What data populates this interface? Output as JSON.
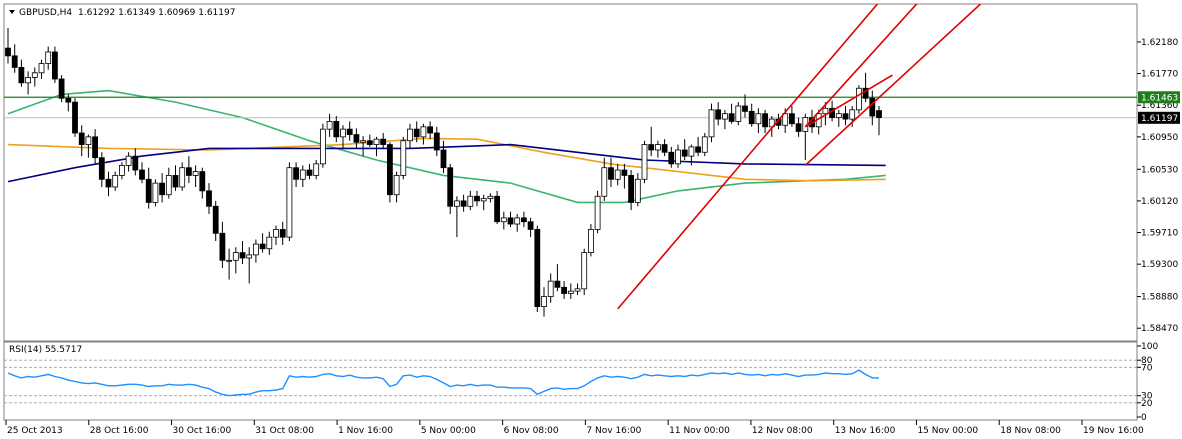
{
  "chart_data": {
    "type": "candlestick",
    "symbol_header": "GBPUSD,H4",
    "ohlc_header": "1.61292 1.61349 1.60969 1.61197",
    "y_ticks": [
      "1.62180",
      "1.61770",
      "1.61360",
      "1.60950",
      "1.60530",
      "1.60120",
      "1.59710",
      "1.59300",
      "1.58880",
      "1.58470"
    ],
    "ylim": [
      1.5833,
      1.6262
    ],
    "x_tick_labels": [
      "25 Oct 2013",
      "28 Oct 16:00",
      "30 Oct 16:00",
      "31 Oct 08:00",
      "1 Nov 16:00",
      "5 Nov 00:00",
      "6 Nov 08:00",
      "7 Nov 16:00",
      "11 Nov 00:00",
      "12 Nov 08:00",
      "13 Nov 16:00",
      "15 Nov 00:00",
      "18 Nov 08:00",
      "19 Nov 16:00"
    ],
    "resistance_level": {
      "value": 1.61463,
      "label": "1.61463",
      "color": "#1e7e1e"
    },
    "current_price": {
      "value": 1.61197,
      "label": "1.61197"
    },
    "candles": [
      [
        1.621,
        1.6236,
        1.619,
        1.62
      ],
      [
        1.62,
        1.6215,
        1.6178,
        1.6185
      ],
      [
        1.6185,
        1.6195,
        1.616,
        1.6165
      ],
      [
        1.6165,
        1.618,
        1.615,
        1.6172
      ],
      [
        1.6172,
        1.6185,
        1.616,
        1.6178
      ],
      [
        1.6178,
        1.6195,
        1.617,
        1.619
      ],
      [
        1.619,
        1.6212,
        1.6182,
        1.6205
      ],
      [
        1.6205,
        1.6212,
        1.6165,
        1.617
      ],
      [
        1.617,
        1.6175,
        1.614,
        1.6145
      ],
      [
        1.6145,
        1.615,
        1.6128,
        1.614
      ],
      [
        1.614,
        1.6145,
        1.6095,
        1.61
      ],
      [
        1.61,
        1.611,
        1.607,
        1.6085
      ],
      [
        1.6085,
        1.6098,
        1.6068,
        1.6095
      ],
      [
        1.6095,
        1.6105,
        1.606,
        1.6068
      ],
      [
        1.6068,
        1.6075,
        1.603,
        1.604
      ],
      [
        1.604,
        1.605,
        1.6018,
        1.603
      ],
      [
        1.603,
        1.605,
        1.6025,
        1.6045
      ],
      [
        1.6045,
        1.6062,
        1.604,
        1.6058
      ],
      [
        1.6058,
        1.6075,
        1.605,
        1.607
      ],
      [
        1.607,
        1.608,
        1.6045,
        1.6052
      ],
      [
        1.6052,
        1.6062,
        1.6035,
        1.604
      ],
      [
        1.604,
        1.6055,
        1.6002,
        1.601
      ],
      [
        1.601,
        1.604,
        1.6005,
        1.6035
      ],
      [
        1.6035,
        1.6048,
        1.601,
        1.602
      ],
      [
        1.602,
        1.6055,
        1.6015,
        1.6045
      ],
      [
        1.6045,
        1.6058,
        1.6025,
        1.603
      ],
      [
        1.603,
        1.6062,
        1.6025,
        1.6055
      ],
      [
        1.6055,
        1.607,
        1.6035,
        1.6045
      ],
      [
        1.6045,
        1.6058,
        1.603,
        1.605
      ],
      [
        1.605,
        1.6055,
        1.6015,
        1.6025
      ],
      [
        1.6025,
        1.6035,
        1.5995,
        1.6005
      ],
      [
        1.6005,
        1.6012,
        1.596,
        1.597
      ],
      [
        1.597,
        1.5985,
        1.5925,
        1.5935
      ],
      [
        1.5935,
        1.595,
        1.591,
        1.5935
      ],
      [
        1.5935,
        1.5952,
        1.5918,
        1.5945
      ],
      [
        1.5945,
        1.596,
        1.593,
        1.5938
      ],
      [
        1.5938,
        1.5952,
        1.5905,
        1.5942
      ],
      [
        1.5942,
        1.5962,
        1.5932,
        1.5956
      ],
      [
        1.5956,
        1.597,
        1.5945,
        1.595
      ],
      [
        1.595,
        1.5972,
        1.5942,
        1.5965
      ],
      [
        1.5965,
        1.598,
        1.5955,
        1.5975
      ],
      [
        1.5975,
        1.5985,
        1.5955,
        1.5965
      ],
      [
        1.5965,
        1.6062,
        1.596,
        1.6055
      ],
      [
        1.6055,
        1.6062,
        1.603,
        1.604
      ],
      [
        1.604,
        1.6058,
        1.603,
        1.6052
      ],
      [
        1.6052,
        1.606,
        1.604,
        1.6045
      ],
      [
        1.6045,
        1.6065,
        1.604,
        1.606
      ],
      [
        1.606,
        1.6112,
        1.6055,
        1.6105
      ],
      [
        1.6105,
        1.6125,
        1.6095,
        1.6115
      ],
      [
        1.6115,
        1.6122,
        1.6088,
        1.6095
      ],
      [
        1.6095,
        1.611,
        1.608,
        1.6105
      ],
      [
        1.6105,
        1.6115,
        1.609,
        1.6098
      ],
      [
        1.6098,
        1.6106,
        1.608,
        1.6088
      ],
      [
        1.6088,
        1.6096,
        1.607,
        1.609
      ],
      [
        1.609,
        1.6098,
        1.6082,
        1.6085
      ],
      [
        1.6085,
        1.6095,
        1.607,
        1.6092
      ],
      [
        1.6092,
        1.61,
        1.608,
        1.6085
      ],
      [
        1.6085,
        1.6088,
        1.601,
        1.602
      ],
      [
        1.602,
        1.605,
        1.601,
        1.6045
      ],
      [
        1.6045,
        1.6095,
        1.604,
        1.609
      ],
      [
        1.609,
        1.6112,
        1.608,
        1.6105
      ],
      [
        1.6105,
        1.6115,
        1.6088,
        1.6095
      ],
      [
        1.6095,
        1.6112,
        1.6085,
        1.6108
      ],
      [
        1.6108,
        1.6115,
        1.6092,
        1.61
      ],
      [
        1.61,
        1.6108,
        1.607,
        1.6078
      ],
      [
        1.6078,
        1.609,
        1.6048,
        1.6055
      ],
      [
        1.6055,
        1.606,
        1.5995,
        1.6005
      ],
      [
        1.6005,
        1.6018,
        1.5965,
        1.6012
      ],
      [
        1.6012,
        1.602,
        1.5998,
        1.6005
      ],
      [
        1.6005,
        1.6025,
        1.6,
        1.6018
      ],
      [
        1.6018,
        1.6025,
        1.6005,
        1.6012
      ],
      [
        1.6012,
        1.602,
        1.6,
        1.6015
      ],
      [
        1.6015,
        1.6022,
        1.601,
        1.6018
      ],
      [
        1.6018,
        1.6025,
        1.5982,
        1.5985
      ],
      [
        1.5985,
        1.5998,
        1.5975,
        1.599
      ],
      [
        1.599,
        1.5998,
        1.5978,
        1.5982
      ],
      [
        1.5982,
        1.5995,
        1.5972,
        1.599
      ],
      [
        1.599,
        1.5998,
        1.5978,
        1.5985
      ],
      [
        1.5985,
        1.599,
        1.5965,
        1.5975
      ],
      [
        1.5975,
        1.598,
        1.5868,
        1.5875
      ],
      [
        1.5875,
        1.59,
        1.5862,
        1.5888
      ],
      [
        1.5888,
        1.5918,
        1.588,
        1.5908
      ],
      [
        1.5908,
        1.593,
        1.5895,
        1.59
      ],
      [
        1.59,
        1.5908,
        1.5885,
        1.5892
      ],
      [
        1.5892,
        1.5905,
        1.5885,
        1.5895
      ],
      [
        1.5895,
        1.5905,
        1.589,
        1.5898
      ],
      [
        1.5898,
        1.595,
        1.589,
        1.5945
      ],
      [
        1.5945,
        1.5982,
        1.594,
        1.5975
      ],
      [
        1.5975,
        1.6025,
        1.597,
        1.6018
      ],
      [
        1.6018,
        1.6068,
        1.6012,
        1.6055
      ],
      [
        1.6055,
        1.6068,
        1.603,
        1.604
      ],
      [
        1.604,
        1.606,
        1.6032,
        1.6052
      ],
      [
        1.6052,
        1.606,
        1.6028,
        1.6045
      ],
      [
        1.6045,
        1.6052,
        1.6,
        1.601
      ],
      [
        1.601,
        1.6048,
        1.6005,
        1.604
      ],
      [
        1.604,
        1.609,
        1.6035,
        1.6085
      ],
      [
        1.6085,
        1.6108,
        1.607,
        1.6078
      ],
      [
        1.6078,
        1.609,
        1.6068,
        1.6085
      ],
      [
        1.6085,
        1.6092,
        1.607,
        1.6075
      ],
      [
        1.6075,
        1.6082,
        1.6055,
        1.606
      ],
      [
        1.606,
        1.6085,
        1.6055,
        1.6078
      ],
      [
        1.6078,
        1.6092,
        1.6065,
        1.607
      ],
      [
        1.607,
        1.6085,
        1.6058,
        1.6082
      ],
      [
        1.6082,
        1.6095,
        1.607,
        1.6075
      ],
      [
        1.6075,
        1.61,
        1.607,
        1.6095
      ],
      [
        1.6095,
        1.6138,
        1.6088,
        1.613
      ],
      [
        1.613,
        1.614,
        1.611,
        1.6118
      ],
      [
        1.6118,
        1.613,
        1.6105,
        1.6125
      ],
      [
        1.6125,
        1.6138,
        1.6112,
        1.6115
      ],
      [
        1.6115,
        1.614,
        1.611,
        1.6135
      ],
      [
        1.6135,
        1.615,
        1.612,
        1.6128
      ],
      [
        1.6128,
        1.6138,
        1.6108,
        1.6112
      ],
      [
        1.6112,
        1.6132,
        1.61,
        1.6125
      ],
      [
        1.6125,
        1.613,
        1.61,
        1.6108
      ],
      [
        1.6108,
        1.6122,
        1.6095,
        1.6118
      ],
      [
        1.6118,
        1.6125,
        1.6105,
        1.611
      ],
      [
        1.611,
        1.6132,
        1.61,
        1.6125
      ],
      [
        1.6125,
        1.6135,
        1.6108,
        1.6112
      ],
      [
        1.6112,
        1.612,
        1.6095,
        1.6102
      ],
      [
        1.6102,
        1.6125,
        1.6065,
        1.612
      ],
      [
        1.612,
        1.613,
        1.61,
        1.6108
      ],
      [
        1.6108,
        1.613,
        1.6098,
        1.6125
      ],
      [
        1.6125,
        1.614,
        1.611,
        1.6132
      ],
      [
        1.6132,
        1.6142,
        1.6115,
        1.612
      ],
      [
        1.612,
        1.613,
        1.6108,
        1.6125
      ],
      [
        1.6125,
        1.6135,
        1.611,
        1.6118
      ],
      [
        1.6118,
        1.6135,
        1.6108,
        1.613
      ],
      [
        1.613,
        1.6162,
        1.6125,
        1.6158
      ],
      [
        1.6158,
        1.6178,
        1.614,
        1.6145
      ],
      [
        1.6145,
        1.6155,
        1.611,
        1.6122
      ],
      [
        1.6129,
        1.6135,
        1.6097,
        1.612
      ]
    ],
    "ma_series": [
      {
        "color": "#3cb371",
        "values": [
          [
            0,
            1.6125
          ],
          [
            8,
            1.615
          ],
          [
            15,
            1.6155
          ],
          [
            25,
            1.614
          ],
          [
            35,
            1.612
          ],
          [
            45,
            1.609
          ],
          [
            55,
            1.6065
          ],
          [
            65,
            1.6045
          ],
          [
            75,
            1.6035
          ],
          [
            85,
            1.601
          ],
          [
            92,
            1.601
          ],
          [
            100,
            1.6025
          ],
          [
            110,
            1.6035
          ],
          [
            125,
            1.604
          ],
          [
            131,
            1.6045
          ]
        ]
      },
      {
        "color": "#f0a020",
        "values": [
          [
            0,
            1.6085
          ],
          [
            15,
            1.608
          ],
          [
            30,
            1.6078
          ],
          [
            50,
            1.6085
          ],
          [
            62,
            1.6093
          ],
          [
            70,
            1.6092
          ],
          [
            80,
            1.6075
          ],
          [
            90,
            1.606
          ],
          [
            100,
            1.605
          ],
          [
            110,
            1.604
          ],
          [
            120,
            1.6038
          ],
          [
            131,
            1.604
          ]
        ]
      },
      {
        "color": "#000080",
        "values": [
          [
            0,
            1.6037
          ],
          [
            10,
            1.6055
          ],
          [
            20,
            1.607
          ],
          [
            30,
            1.608
          ],
          [
            45,
            1.608
          ],
          [
            60,
            1.608
          ],
          [
            75,
            1.6085
          ],
          [
            85,
            1.6075
          ],
          [
            95,
            1.6065
          ],
          [
            110,
            1.606
          ],
          [
            131,
            1.6058
          ]
        ]
      }
    ],
    "trendlines": [
      {
        "x1": 91,
        "y1": 1.5872,
        "x2": 132,
        "y2": 1.629
      },
      {
        "x1": 119,
        "y1": 1.6058,
        "x2": 148,
        "y2": 1.629
      },
      {
        "x1": 119,
        "y1": 1.6108,
        "x2": 138,
        "y2": 1.629
      },
      {
        "x1": 119,
        "y1": 1.6108,
        "x2": 132,
        "y2": 1.6175
      }
    ],
    "rsi": {
      "title": "RSI(14) 55.5717",
      "y_ticks": [
        "100",
        "80",
        "70",
        "30",
        "20",
        "0"
      ],
      "levels": [
        80,
        70,
        30,
        20
      ],
      "color": "#1e90ff",
      "values": [
        62,
        58,
        55,
        57,
        56,
        58,
        60,
        57,
        55,
        52,
        50,
        48,
        47,
        48,
        46,
        44,
        44,
        45,
        46,
        46,
        45,
        43,
        44,
        44,
        46,
        45,
        45,
        46,
        45,
        42,
        40,
        35,
        32,
        30,
        31,
        32,
        32,
        35,
        37,
        37,
        38,
        40,
        58,
        56,
        57,
        56,
        57,
        60,
        61,
        58,
        57,
        59,
        56,
        55,
        55,
        56,
        54,
        43,
        46,
        58,
        59,
        56,
        58,
        57,
        53,
        48,
        43,
        45,
        44,
        46,
        44,
        45,
        45,
        42,
        42,
        41,
        41,
        41,
        40,
        32,
        36,
        40,
        41,
        39,
        40,
        40,
        44,
        50,
        55,
        58,
        56,
        57,
        56,
        54,
        56,
        60,
        58,
        59,
        58,
        57,
        58,
        57,
        59,
        58,
        60,
        62,
        61,
        62,
        60,
        62,
        60,
        59,
        60,
        58,
        60,
        59,
        61,
        59,
        57,
        59,
        59,
        60,
        62,
        61,
        61,
        60,
        61,
        66,
        60,
        55,
        55
      ]
    }
  }
}
